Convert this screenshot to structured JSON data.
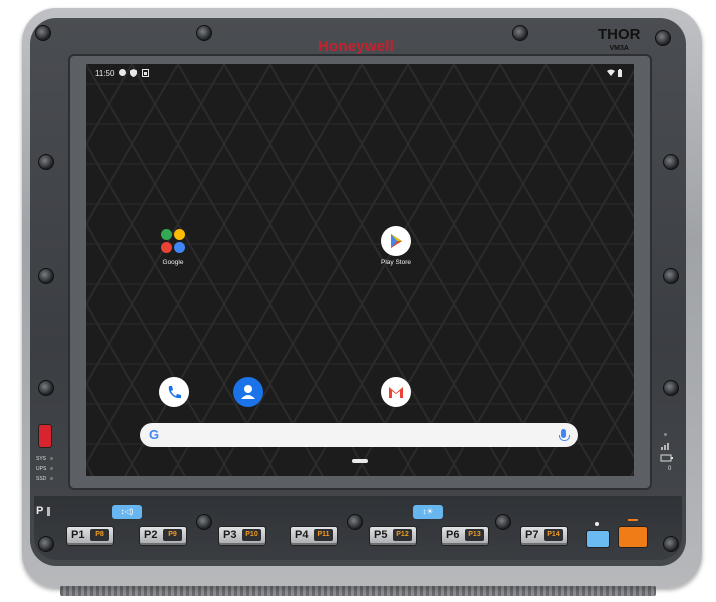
{
  "device": {
    "brand": "Honeywell",
    "model": "THOR",
    "model_sub": "VM3A",
    "side_indicators": [
      "SYS",
      "UPS",
      "SSD"
    ],
    "right_indicator_text": "0",
    "p_label": "P",
    "volume_icon": "↕◁)",
    "brightness_icon": "↕☀"
  },
  "status_bar": {
    "time": "11:50",
    "icons": [
      "notification-dot-icon",
      "shield-icon",
      "sim-icon",
      "wifi-icon",
      "battery-icon"
    ]
  },
  "apps": [
    {
      "label": "Google",
      "icon": "google-folder-icon"
    },
    {
      "label": "Play Store",
      "icon": "play-store-icon"
    }
  ],
  "dock": [
    {
      "icon": "phone-icon"
    },
    {
      "icon": "contacts-icon"
    },
    {
      "icon": "gmail-icon"
    }
  ],
  "search": {
    "logo": "G",
    "icon": "mic-icon"
  },
  "keys": [
    {
      "p": "P1",
      "q": "P8"
    },
    {
      "p": "P2",
      "q": "P9"
    },
    {
      "p": "P3",
      "q": "P10"
    },
    {
      "p": "P4",
      "q": "P11"
    },
    {
      "p": "P5",
      "q": "P12"
    },
    {
      "p": "P6",
      "q": "P13"
    },
    {
      "p": "P7",
      "q": "P14"
    }
  ],
  "colors": {
    "brand_red": "#c8202c",
    "key_blue": "#67b6f0",
    "key_orange": "#f07c18"
  }
}
